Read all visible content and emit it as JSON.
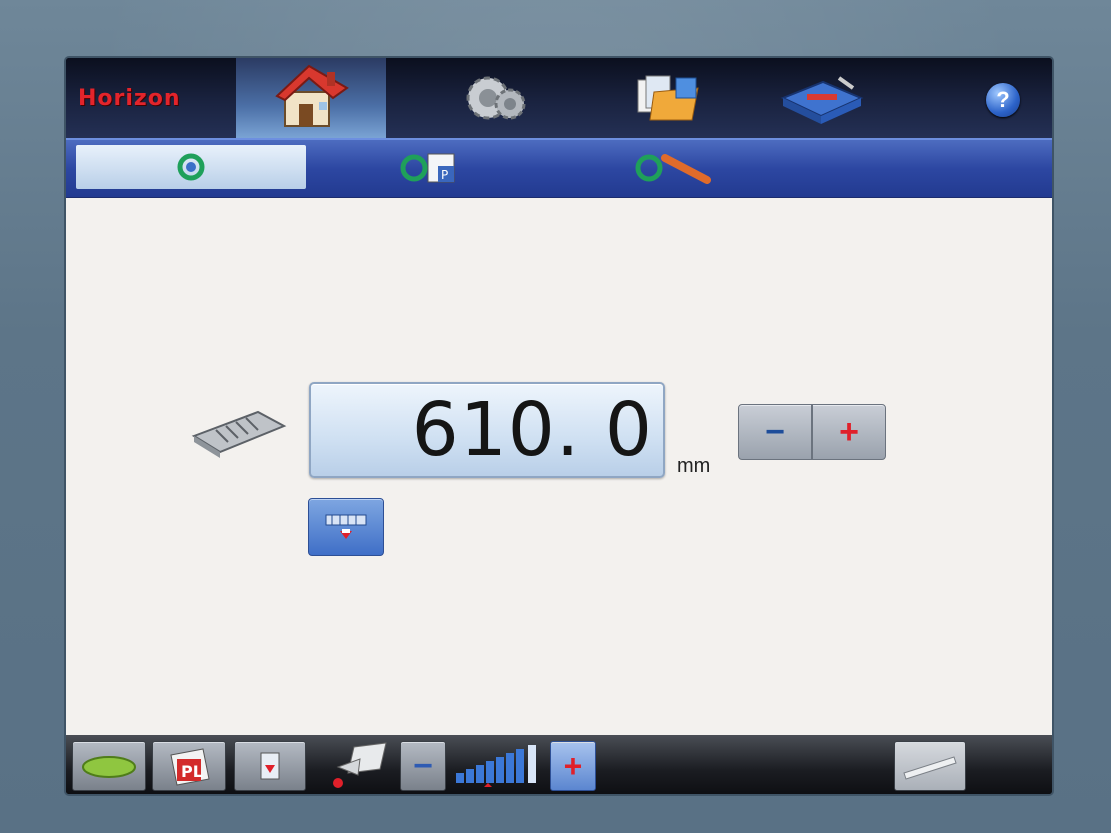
{
  "app": {
    "brand": "Horizon"
  },
  "header": {
    "tabs": [
      {
        "icon": "home-icon",
        "active": true
      },
      {
        "icon": "gears-icon",
        "active": false
      },
      {
        "icon": "folder-files-icon",
        "active": false
      },
      {
        "icon": "toolbox-icon",
        "active": false
      }
    ],
    "help_label": "?"
  },
  "subtabs": [
    {
      "icon": "cycle-icon",
      "active": true
    },
    {
      "icon": "cycle-program-icon",
      "active": false
    },
    {
      "icon": "cycle-knife-icon",
      "active": false
    }
  ],
  "main": {
    "value": "610. 0",
    "unit": "mm",
    "stepper": {
      "minus_label": "−",
      "plus_label": "+"
    }
  },
  "bottombar": {
    "minus_label": "−",
    "plus_label": "+"
  },
  "colors": {
    "brand": "#e3242b",
    "accent_blue": "#3f6fc7",
    "plus_red": "#e0202a"
  }
}
